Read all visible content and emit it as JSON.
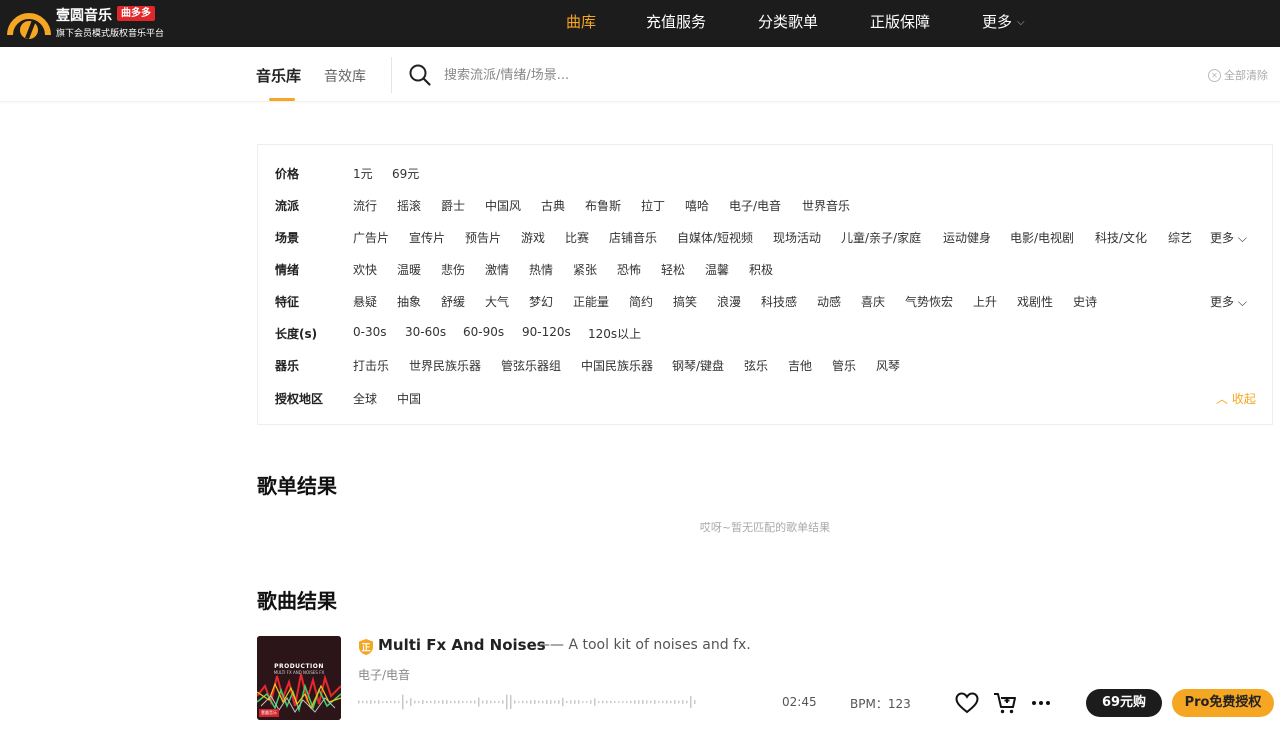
{
  "brand": {
    "name": "壹圆音乐",
    "badge": "曲多多",
    "tagline": "旗下会员模式版权音乐平台"
  },
  "nav": [
    {
      "label": "曲库",
      "active": true
    },
    {
      "label": "充值服务"
    },
    {
      "label": "分类歌单"
    },
    {
      "label": "正版保障"
    },
    {
      "label": "更多"
    }
  ],
  "search": {
    "tab_music": "音乐库",
    "tab_sfx": "音效库",
    "placeholder": "搜索流派/情绪/场景...",
    "clear_all": "全部清除"
  },
  "filters": {
    "more_label": "更多",
    "collapse_label": "收起",
    "rows": [
      {
        "label": "价格",
        "items": [
          "1元",
          "69元"
        ]
      },
      {
        "label": "流派",
        "items": [
          "流行",
          "摇滚",
          "爵士",
          "中国风",
          "古典",
          "布鲁斯",
          "拉丁",
          "嘻哈",
          "电子/电音",
          "世界音乐"
        ]
      },
      {
        "label": "场景",
        "items": [
          "广告片",
          "宣传片",
          "预告片",
          "游戏",
          "比赛",
          "店铺音乐",
          "自媒体/短视频",
          "现场活动",
          "儿童/亲子/家庭",
          "运动健身",
          "电影/电视剧",
          "科技/文化",
          "综艺"
        ]
      },
      {
        "label": "情绪",
        "items": [
          "欢快",
          "温暖",
          "悲伤",
          "激情",
          "热情",
          "紧张",
          "恐怖",
          "轻松",
          "温馨",
          "积极"
        ]
      },
      {
        "label": "特征",
        "items": [
          "悬疑",
          "抽象",
          "舒缓",
          "大气",
          "梦幻",
          "正能量",
          "简约",
          "搞笑",
          "浪漫",
          "科技感",
          "动感",
          "喜庆",
          "气势恢宏",
          "上升",
          "戏剧性",
          "史诗"
        ]
      },
      {
        "label": "长度(s)",
        "items": [
          "0-30s",
          "30-60s",
          "60-90s",
          "90-120s",
          "120s以上"
        ]
      },
      {
        "label": "器乐",
        "items": [
          "打击乐",
          "世界民族乐器",
          "管弦乐器组",
          "中国民族乐器",
          "钢琴/键盘",
          "弦乐",
          "吉他",
          "管乐",
          "风琴"
        ]
      },
      {
        "label": "授权地区",
        "items": [
          "全球",
          "中国"
        ]
      }
    ]
  },
  "playlist_results": {
    "title": "歌单结果",
    "empty": "哎呀~暂无匹配的歌单结果"
  },
  "song_results": {
    "title": "歌曲结果"
  },
  "song": {
    "cover_title": "PRODUCTION",
    "cover_subtitle": "MULTI FX AND NOISES FX",
    "cover_tag": "壹圆音乐",
    "badge": "正",
    "title": "Multi Fx And Noises",
    "description": "—— A tool kit of noises and fx.",
    "genre": "电子/电音",
    "duration": "02:45",
    "bpm": "BPM：123",
    "buy_label": "69元购",
    "pro_label": "Pro免费授权"
  },
  "colors": {
    "accent": "#f5a623",
    "topbar": "#1c1c1c",
    "badge_red": "#e0282a"
  },
  "icons": [
    "logo-icon",
    "search-icon",
    "clear-icon",
    "chevron-down-icon",
    "chevron-up-icon",
    "heart-icon",
    "cart-icon",
    "more-icon"
  ]
}
